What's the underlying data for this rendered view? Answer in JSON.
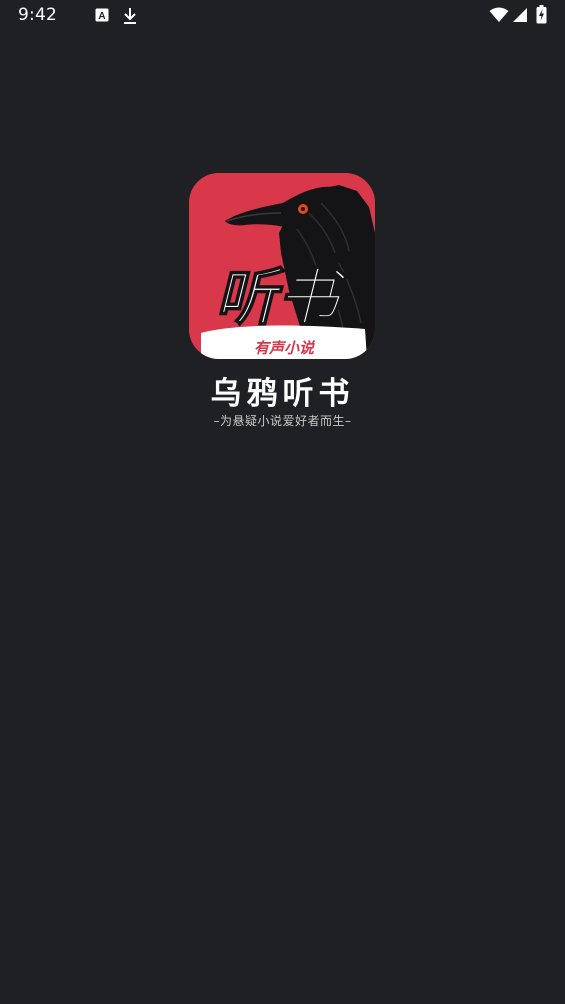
{
  "status_bar": {
    "time": "9:42",
    "icons": [
      "font-a-icon",
      "download-icon",
      "wifi-icon",
      "cellular-signal-icon",
      "battery-charging-icon"
    ]
  },
  "splash": {
    "app_icon": {
      "title_text": "听书",
      "ribbon_text": "有声小说",
      "icon_name": "crow-icon",
      "colors": {
        "background": "#d9374a",
        "crow": "#141416",
        "eye": "#e04b1a",
        "ribbon": "#ffffff",
        "ribbon_text": "#d9374a"
      }
    },
    "app_name": "乌鸦听书",
    "slogan": "–为悬疑小说爱好者而生–"
  },
  "colors": {
    "background": "#1f2023",
    "text_primary": "#ffffff",
    "text_secondary": "#c8c8c8"
  }
}
